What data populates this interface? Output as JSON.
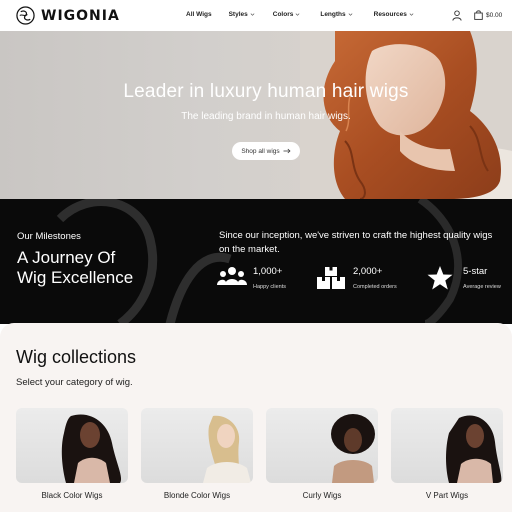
{
  "header": {
    "brand": "WIGONIA",
    "nav": [
      {
        "label": "All Wigs",
        "dropdown": false
      },
      {
        "label": "Styles",
        "dropdown": true
      },
      {
        "label": "Colors",
        "dropdown": true
      },
      {
        "label": "Lengths",
        "dropdown": true
      },
      {
        "label": "Resources",
        "dropdown": true
      }
    ],
    "cart_total": "$0.00",
    "icons": {
      "account": "user-icon",
      "cart": "shopping-bag-icon"
    }
  },
  "hero": {
    "title": "Leader in luxury human hair wigs",
    "subtitle": "The leading brand in human hair wigs.",
    "cta_label": "Shop all wigs"
  },
  "milestones": {
    "label": "Our Milestones",
    "heading_line1": "A Journey Of",
    "heading_line2": "Wig Excellence",
    "description": "Since our inception, we've striven to craft the highest quality wigs on the market.",
    "stats": [
      {
        "value": "1,000+",
        "caption": "Happy clients",
        "icon": "people-icon"
      },
      {
        "value": "2,000+",
        "caption": "Completed orders",
        "icon": "boxes-icon"
      },
      {
        "value": "5-star",
        "caption": "Average review",
        "icon": "star-icon"
      }
    ]
  },
  "collections": {
    "title": "Wig collections",
    "subtitle": "Select your category of wig.",
    "cards": [
      {
        "label": "Black Color Wigs"
      },
      {
        "label": "Blonde Color Wigs"
      },
      {
        "label": "Curly Wigs"
      },
      {
        "label": "V Part Wigs"
      }
    ]
  },
  "colors": {
    "dark": "#0a0a0a",
    "cream": "#f8f4f2",
    "hair": "#b5582a"
  }
}
